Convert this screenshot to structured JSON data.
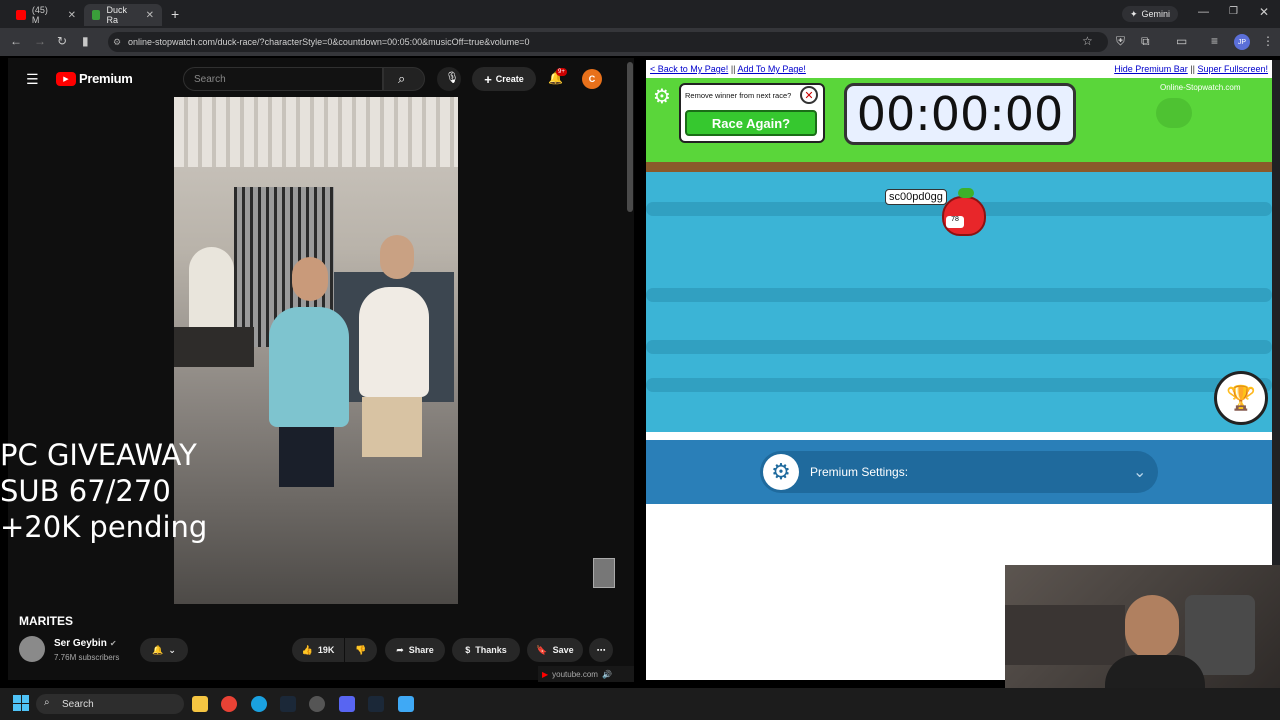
{
  "browser": {
    "tabs": [
      {
        "label": "(45) M",
        "active": false
      },
      {
        "label": "Duck Ra",
        "active": true
      }
    ],
    "new_tab": "+",
    "url": "online-stopwatch.com/duck-race/?characterStyle=0&countdown=00:05:00&musicOff=true&volume=0",
    "gemini_label": "Gemini",
    "profile_initials": "JP"
  },
  "youtube": {
    "brand": "Premium",
    "search_placeholder": "Search",
    "create_label": "Create",
    "notif_badge": "9+",
    "avatar_letter": "C",
    "overlay_text": [
      "PC GIVEAWAY",
      "SUB 67/270",
      "+20K pending"
    ],
    "video_title": "MARITES",
    "channel_name": "Ser Geybin",
    "subscribers": "7.76M subscribers",
    "likes": "19K",
    "share_label": "Share",
    "thanks_label": "Thanks",
    "save_label": "Save",
    "origin_label": "youtube.com"
  },
  "site": {
    "back_link": "< Back to My Page!",
    "add_link": "Add To My Page!",
    "separator": "||",
    "hide_premium": "Hide Premium Bar",
    "super_fullscreen": "Super Fullscreen!",
    "logo_text": "Online-Stopwatch.com",
    "remove_winner_label": "Remove winner from next race?",
    "race_again_label": "Race Again?",
    "timer": "00:00:00",
    "racer_name": "sc00pd0gg",
    "racer_number": "78",
    "premium_settings_label": "Premium Settings:"
  },
  "taskbar": {
    "search_label": "Search"
  },
  "colors": {
    "youtube_red": "#ff0000",
    "grass": "#5ad63a",
    "water": "#3bb4d6",
    "race_button": "#36c82f",
    "premium_bar": "#2a7fb8"
  }
}
